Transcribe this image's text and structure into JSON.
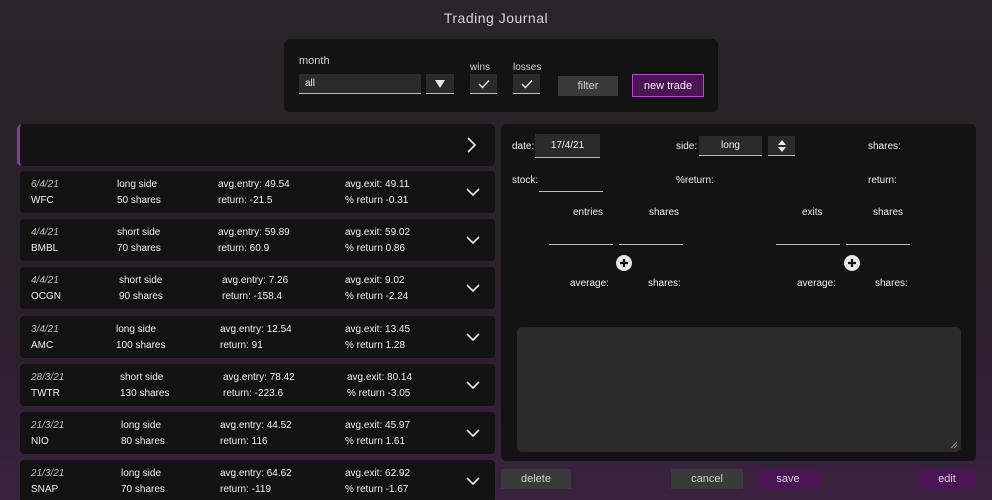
{
  "app": {
    "title": "Trading Journal"
  },
  "filter": {
    "month_label": "month",
    "month_value": "all",
    "wins_label": "wins",
    "losses_label": "losses",
    "filter_button": "filter",
    "new_trade_button": "new trade",
    "wins_checked": true,
    "losses_checked": true
  },
  "trades": [
    {
      "date": "6/4/21",
      "ticker": "WFC",
      "side": "long side",
      "shares": "50 shares",
      "avg_entry": "avg.entry: 49.54",
      "return": "return: -21.5",
      "avg_exit": "avg.exit: 49.11",
      "pct_return": "% return -0.31"
    },
    {
      "date": "4/4/21",
      "ticker": "BMBL",
      "side": "short side",
      "shares": "70 shares",
      "avg_entry": "avg.entry: 59.89",
      "return": "return: 60.9",
      "avg_exit": "avg.exit: 59.02",
      "pct_return": "% return 0.86"
    },
    {
      "date": "4/4/21",
      "ticker": "OCGN",
      "side": "short side",
      "shares": "90 shares",
      "avg_entry": "avg.entry: 7.26",
      "return": "return: -158.4",
      "avg_exit": "avg.exit: 9.02",
      "pct_return": "% return -2.24"
    },
    {
      "date": "3/4/21",
      "ticker": "AMC",
      "side": "long side",
      "shares": "100 shares",
      "avg_entry": "avg.entry: 12.54",
      "return": "return: 91",
      "avg_exit": "avg.exit: 13.45",
      "pct_return": "% return 1.28"
    },
    {
      "date": "28/3/21",
      "ticker": "TWTR",
      "side": "short side",
      "shares": "130 shares",
      "avg_entry": "avg.entry: 78.42",
      "return": "return: -223.6",
      "avg_exit": "avg.exit: 80.14",
      "pct_return": "% return -3.05"
    },
    {
      "date": "21/3/21",
      "ticker": "NIO",
      "side": "long side",
      "shares": "80 shares",
      "avg_entry": "avg.entry: 44.52",
      "return": "return: 116",
      "avg_exit": "avg.exit: 45.97",
      "pct_return": "% return 1.61"
    },
    {
      "date": "21/3/21",
      "ticker": "SNAP",
      "side": "long side",
      "shares": "70 shares",
      "avg_entry": "avg.entry: 64.62",
      "return": "return: -119",
      "avg_exit": "avg.exit: 62.92",
      "pct_return": "% return -1.67"
    }
  ],
  "detail": {
    "date_label": "date:",
    "date_value": "17/4/21",
    "side_label": "side:",
    "side_value": "long",
    "shares_label": "shares:",
    "stock_label": "stock:",
    "pct_return_label": "%return:",
    "return_label": "return:",
    "entries_label": "entries",
    "entries_shares_label": "shares",
    "exits_label": "exits",
    "exits_shares_label": "shares",
    "entries_average_label": "average:",
    "entries_avg_shares_label": "shares:",
    "exits_average_label": "average:",
    "exits_avg_shares_label": "shares:"
  },
  "actions": {
    "delete": "delete",
    "cancel": "cancel",
    "save": "save",
    "edit": "edit"
  },
  "colors": {
    "accent": "#4a1455",
    "accent_border": "#b34ad0",
    "panel": "#131313",
    "input": "#2b2b2b"
  }
}
